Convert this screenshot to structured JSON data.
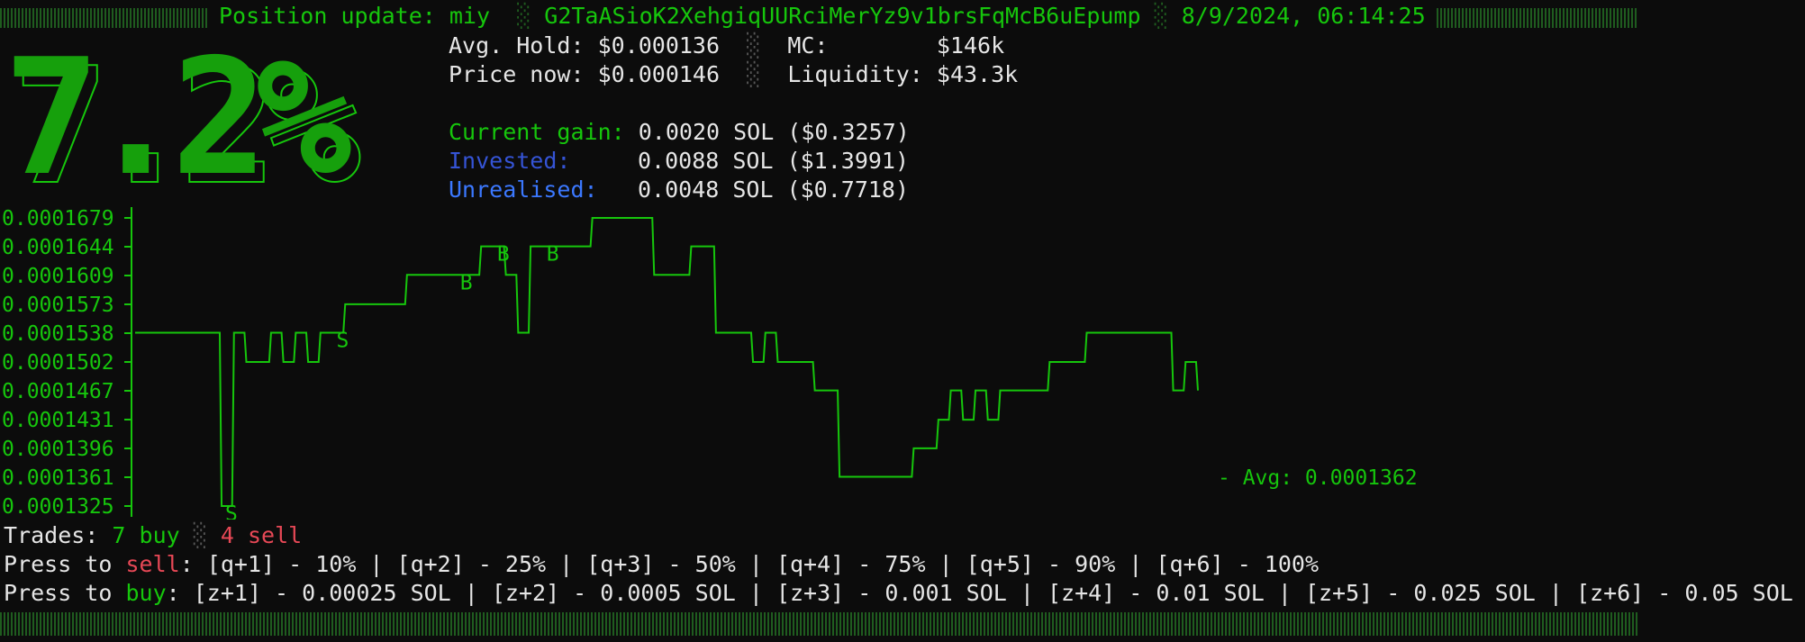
{
  "header": {
    "title": "Position update: miy",
    "sep1": "░",
    "token_address": "G2TaASioK2XehgiqUURciMerYz9v1brsFqMcB6uEpump",
    "sep2": "░",
    "timestamp": "8/9/2024, 06:14:25"
  },
  "big_percent": "7.2%",
  "stats": {
    "avg_hold_label": "Avg. Hold:",
    "avg_hold_value": "$0.000136",
    "sep": "░",
    "mc_label": "MC:",
    "mc_value": "$146k",
    "price_now_label": "Price now:",
    "price_now_value": "$0.000146",
    "liquidity_label": "Liquidity:",
    "liquidity_value": "$43.3k"
  },
  "gains": {
    "current_gain_label": "Current gain:",
    "current_gain_value": "0.0020 SOL ($0.3257)",
    "invested_label": "Invested:",
    "invested_value": "0.0088 SOL ($1.3991)",
    "unrealised_label": "Unrealised:",
    "unrealised_value": "0.0048 SOL ($0.7718)"
  },
  "chart_data": {
    "type": "line",
    "y_tick_labels": [
      "0.0001679",
      "0.0001644",
      "0.0001609",
      "0.0001573",
      "0.0001538",
      "0.0001502",
      "0.0001467",
      "0.0001431",
      "0.0001396",
      "0.0001361",
      "0.0001325"
    ],
    "avg_label": "- Avg: 0.0001362",
    "series": [
      {
        "values": [
          0.0001538,
          0.0001538,
          0.0001538,
          0.0001538,
          0.0001538,
          0.0001538,
          0.0001538,
          0.0001325,
          0.0001538,
          0.0001502,
          0.0001502,
          0.0001538,
          0.0001502,
          0.0001538,
          0.0001502,
          0.0001538,
          0.0001538,
          0.0001573,
          0.0001573,
          0.0001573,
          0.0001573,
          0.0001573,
          0.0001609,
          0.0001609,
          0.0001609,
          0.0001609,
          0.0001609,
          0.0001609,
          0.0001644,
          0.0001644,
          0.0001609,
          0.0001538,
          0.0001644,
          0.0001644,
          0.0001644,
          0.0001644,
          0.0001644,
          0.0001679,
          0.0001679,
          0.0001679,
          0.0001679,
          0.0001679,
          0.0001609,
          0.0001609,
          0.0001609,
          0.0001644,
          0.0001644,
          0.0001538,
          0.0001538,
          0.0001538,
          0.0001502,
          0.0001538,
          0.0001502,
          0.0001502,
          0.0001502,
          0.0001467,
          0.0001467,
          0.0001361,
          0.0001361,
          0.0001361,
          0.0001361,
          0.0001361,
          0.0001361,
          0.0001396,
          0.0001396,
          0.0001431,
          0.0001467,
          0.0001431,
          0.0001467,
          0.0001431,
          0.0001467,
          0.0001467,
          0.0001467,
          0.0001467,
          0.0001502,
          0.0001502,
          0.0001502,
          0.0001538,
          0.0001538,
          0.0001538,
          0.0001538,
          0.0001538,
          0.0001538,
          0.0001538,
          0.0001467,
          0.0001502,
          0.0001467
        ]
      }
    ],
    "markers": [
      {
        "index": 7,
        "label": "S"
      },
      {
        "index": 16,
        "label": "S"
      },
      {
        "index": 26,
        "label": "B"
      },
      {
        "index": 29,
        "label": "B"
      },
      {
        "index": 33,
        "label": "B"
      }
    ],
    "line_color": "#16c60c"
  },
  "trades": {
    "label": "Trades:",
    "buy_text": "7 buy",
    "sep": "░",
    "sell_text": "4 sell"
  },
  "sell_line": {
    "prefix": "Press to",
    "keyword": "sell",
    "rest": ": [q+1] - 10% | [q+2] - 25% | [q+3] - 50% | [q+4] - 75% | [q+5] - 90% | [q+6] - 100%"
  },
  "buy_line": {
    "prefix": "Press to",
    "keyword": "buy",
    "rest": ": [z+1] - 0.00025 SOL | [z+2] - 0.0005 SOL | [z+3] - 0.001 SOL | [z+4] - 0.01 SOL | [z+5] - 0.025 SOL | [z+6] - 0.05 SOL"
  },
  "colors": {
    "accent_green": "#16c60c",
    "invested_blue": "#3554d6",
    "unrealised_blue": "#3b78ff",
    "sell_red": "#e74856",
    "background": "#0c0c0c"
  }
}
